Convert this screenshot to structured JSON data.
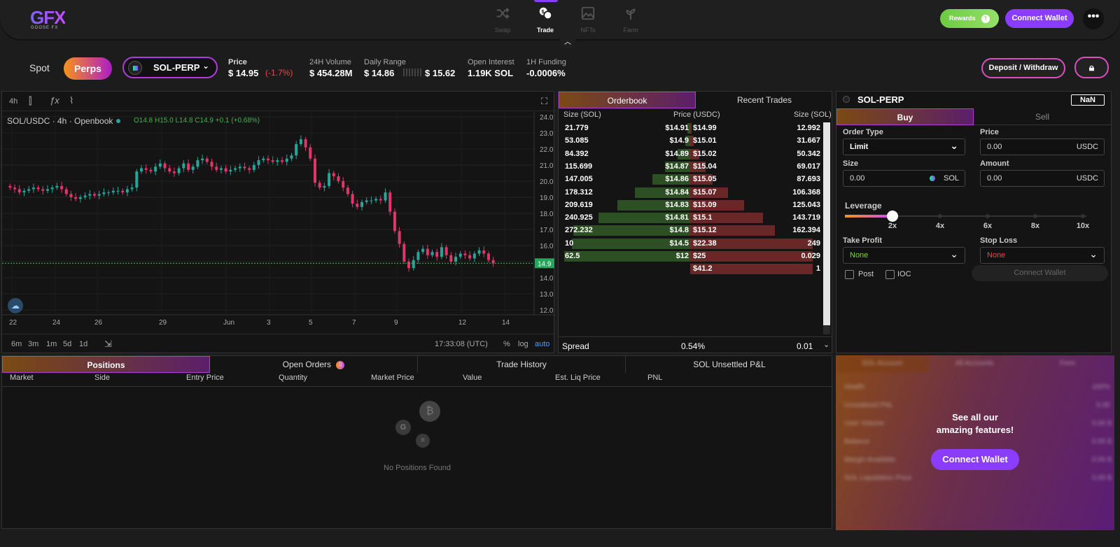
{
  "nav": {
    "logo": "GFX",
    "logo_sub": "GOOSE FX",
    "items": [
      {
        "label": "Swap",
        "icon": "shuffle-icon"
      },
      {
        "label": "Trade",
        "icon": "trade-icon"
      },
      {
        "label": "NFTs",
        "icon": "image-icon"
      },
      {
        "label": "Farm",
        "icon": "sprout-icon"
      }
    ],
    "rewards_label": "Rewards",
    "connect_label": "Connect Wallet",
    "more_label": "•••"
  },
  "market": {
    "spot_label": "Spot",
    "perps_label": "Perps",
    "pair": "SOL-PERP",
    "price_label": "Price",
    "price_value": "$ 14.95",
    "price_change": "(-1.7%)",
    "volume_label": "24H Volume",
    "volume_value": "$ 454.28M",
    "range_label": "Daily Range",
    "range_low": "$ 14.86",
    "range_high": "$ 15.62",
    "oi_label": "Open Interest",
    "oi_value": "1.19K SOL",
    "funding_label": "1H Funding",
    "funding_value": "-0.0006%",
    "deposit_label": "Deposit / Withdraw"
  },
  "chart": {
    "interval": "4h",
    "legend": "SOL/USDC · 4h · Openbook",
    "ohlc": "O14.8  H15.0  L14.8  C14.9  +0.1 (+0.68%)",
    "price_tag": "14.9",
    "time": "17:33:08 (UTC)",
    "ranges": [
      "6m",
      "3m",
      "1m",
      "5d",
      "1d"
    ],
    "scale_opts": [
      "%",
      "log",
      "auto"
    ],
    "colors": {
      "up": "#26a69a",
      "down": "#e0366b",
      "green": "#4caf50"
    }
  },
  "chart_data": {
    "type": "candlestick",
    "x_ticks": [
      "22",
      "24",
      "26",
      "29",
      "Jun",
      "3",
      "5",
      "7",
      "9",
      "12",
      "14"
    ],
    "y_ticks": [
      24.0,
      23.0,
      22.0,
      21.0,
      20.0,
      19.0,
      18.0,
      17.0,
      16.0,
      15.0,
      14.0,
      13.0,
      12.0
    ],
    "ylim": [
      11.7,
      24.3
    ],
    "last_price": 14.9,
    "closes": [
      19.6,
      19.5,
      19.3,
      19.4,
      19.5,
      19.6,
      19.5,
      19.4,
      19.5,
      19.6,
      19.7,
      19.5,
      19.2,
      19.0,
      18.9,
      19.0,
      19.1,
      19.2,
      19.1,
      19.2,
      19.3,
      19.3,
      19.4,
      19.4,
      19.3,
      19.5,
      19.6,
      20.6,
      20.8,
      20.7,
      20.6,
      20.9,
      21.1,
      20.8,
      20.6,
      20.5,
      20.8,
      21.1,
      20.7,
      20.9,
      21.3,
      21.4,
      21.2,
      20.9,
      20.7,
      20.8,
      20.6,
      20.7,
      20.8,
      20.9,
      20.8,
      20.7,
      21.0,
      21.3,
      21.4,
      21.3,
      21.2,
      21.3,
      21.2,
      21.4,
      21.6,
      22.3,
      22.6,
      22.1,
      21.4,
      19.9,
      19.6,
      19.7,
      20.5,
      20.3,
      20.0,
      19.6,
      19.2,
      18.6,
      18.4,
      18.7,
      18.8,
      18.8,
      18.9,
      18.8,
      19.3,
      18.1,
      16.9,
      16.1,
      15.0,
      14.6,
      15.1,
      15.6,
      15.8,
      15.4,
      15.6,
      15.3,
      15.9,
      15.4,
      15.0,
      15.3,
      15.5,
      15.4,
      15.2,
      15.5,
      15.7,
      15.5,
      15.1,
      14.9
    ]
  },
  "orderbook": {
    "tabs": [
      "Orderbook",
      "Recent Trades"
    ],
    "headers": [
      "Size (SOL)",
      "Price (USDC)",
      "Size (SOL)"
    ],
    "bids": [
      {
        "size": "21.779",
        "price": "$14.91",
        "depth": 0.02
      },
      {
        "size": "53.085",
        "price": "$14.9",
        "depth": 0.04
      },
      {
        "size": "84.392",
        "price": "$14.89",
        "depth": 0.1
      },
      {
        "size": "115.699",
        "price": "$14.87",
        "depth": 0.2
      },
      {
        "size": "147.005",
        "price": "$14.86",
        "depth": 0.3
      },
      {
        "size": "178.312",
        "price": "$14.84",
        "depth": 0.44
      },
      {
        "size": "209.619",
        "price": "$14.83",
        "depth": 0.58
      },
      {
        "size": "240.925",
        "price": "$14.81",
        "depth": 0.73
      },
      {
        "size": "272.232",
        "price": "$14.8",
        "depth": 0.93
      },
      {
        "size": "10",
        "price": "$14.5",
        "depth": 0.94
      },
      {
        "size": "62.5",
        "price": "$12",
        "depth": 1.0
      }
    ],
    "asks": [
      {
        "size": "12.992",
        "price": "$14.99",
        "depth": 0.01
      },
      {
        "size": "31.667",
        "price": "$15.01",
        "depth": 0.03
      },
      {
        "size": "50.342",
        "price": "$15.02",
        "depth": 0.07
      },
      {
        "size": "69.017",
        "price": "$15.04",
        "depth": 0.12
      },
      {
        "size": "87.693",
        "price": "$15.05",
        "depth": 0.18
      },
      {
        "size": "106.368",
        "price": "$15.07",
        "depth": 0.3
      },
      {
        "size": "125.043",
        "price": "$15.09",
        "depth": 0.43
      },
      {
        "size": "143.719",
        "price": "$15.1",
        "depth": 0.58
      },
      {
        "size": "162.394",
        "price": "$15.12",
        "depth": 0.67
      },
      {
        "size": "249",
        "price": "$22.38",
        "depth": 0.97
      },
      {
        "size": "0.029",
        "price": "$25",
        "depth": 0.97
      },
      {
        "size": "1",
        "price": "$41.2",
        "depth": 0.97
      }
    ],
    "spread_label": "Spread",
    "spread_value": "0.54%",
    "tick_value": "0.01"
  },
  "order_form": {
    "pair": "SOL-PERP",
    "badge": "NaN",
    "buy_label": "Buy",
    "sell_label": "Sell",
    "order_type_label": "Order Type",
    "order_type_value": "Limit",
    "price_label": "Price",
    "price_value": "0.00",
    "price_unit": "USDC",
    "size_label": "Size",
    "size_value": "0.00",
    "size_unit": "SOL",
    "amount_label": "Amount",
    "amount_value": "0.00",
    "amount_unit": "USDC",
    "leverage_label": "Leverage",
    "leverage_marks": [
      "2x",
      "4x",
      "6x",
      "8x",
      "10x"
    ],
    "leverage_value": 2,
    "tp_label": "Take Profit",
    "tp_value": "None",
    "sl_label": "Stop Loss",
    "sl_value": "None",
    "post_label": "Post",
    "ioc_label": "IOC",
    "connect_label": "Connect Wallet"
  },
  "positions": {
    "tabs": [
      "Positions",
      "Open Orders",
      "Trade History",
      "SOL Unsettled P&L"
    ],
    "open_orders_count": "0",
    "columns": [
      "Market",
      "Side",
      "Entry Price",
      "Quantity",
      "Market Price",
      "Value",
      "Est. Liq Price",
      "PNL"
    ],
    "empty_text": "No Positions Found"
  },
  "account": {
    "tabs": [
      "SOL Account",
      "All Accounts",
      "Fees"
    ],
    "rows": [
      {
        "label": "Health",
        "value": "100%"
      },
      {
        "label": "Unrealized PNL",
        "value": "0.00"
      },
      {
        "label": "User Volume",
        "value": "0.00 $"
      },
      {
        "label": "Balance",
        "value": "0.00 $"
      },
      {
        "label": "Margin Available",
        "value": "0.00 $"
      },
      {
        "label": "SOL Liquidation Price",
        "value": "0.00 $"
      }
    ],
    "promo_line1": "See all our",
    "promo_line2": "amazing features!",
    "connect_label": "Connect Wallet"
  }
}
